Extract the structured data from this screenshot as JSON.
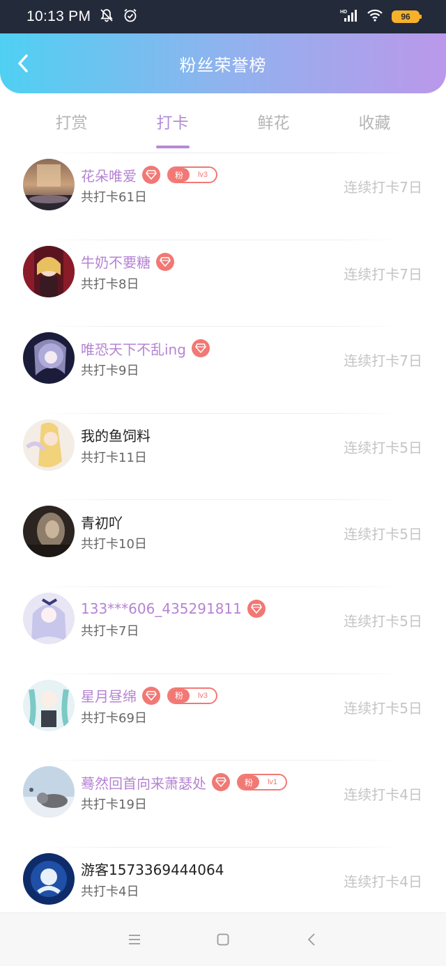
{
  "status_bar": {
    "time": "10:13 PM",
    "battery": "96"
  },
  "header": {
    "title": "粉丝荣誉榜"
  },
  "tabs": [
    {
      "label": "打赏",
      "active": false
    },
    {
      "label": "打卡",
      "active": true
    },
    {
      "label": "鲜花",
      "active": false
    },
    {
      "label": "收藏",
      "active": false
    }
  ],
  "rows": [
    {
      "name": "花朵唯爱",
      "vip": true,
      "fan_badge": "粉",
      "level": "lv3",
      "total": "共打卡61日",
      "streak": "连续打卡7日"
    },
    {
      "name": "牛奶不要糖",
      "vip": true,
      "total": "共打卡8日",
      "streak": "连续打卡7日"
    },
    {
      "name": "唯恐天下不乱ing",
      "vip": true,
      "total": "共打卡9日",
      "streak": "连续打卡7日"
    },
    {
      "name": "我的鱼饲料",
      "vip": false,
      "total": "共打卡11日",
      "streak": "连续打卡5日"
    },
    {
      "name": "青初吖",
      "vip": false,
      "total": "共打卡10日",
      "streak": "连续打卡5日"
    },
    {
      "name": "133***606_435291811",
      "vip": true,
      "total": "共打卡7日",
      "streak": "连续打卡5日"
    },
    {
      "name": "星月昼绵",
      "vip": true,
      "fan_badge": "粉",
      "level": "lv3",
      "total": "共打卡69日",
      "streak": "连续打卡5日"
    },
    {
      "name": "蓦然回首向来萧瑟处",
      "vip": true,
      "fan_badge": "粉",
      "level": "lv1",
      "total": "共打卡19日",
      "streak": "连续打卡4日"
    },
    {
      "name": "游客1573369444064",
      "vip": false,
      "total": "共打卡4日",
      "streak": "连续打卡4日"
    }
  ],
  "colors": {
    "accent": "#b48bd8",
    "vip_name": "#b583d3",
    "badge": "#f17874",
    "header_gradient": [
      "#4fd0f2",
      "#bb98ea"
    ]
  },
  "icons": {
    "status": [
      "mute-bell-icon",
      "alarm-icon",
      "signal-icon",
      "wifi-icon",
      "battery-icon"
    ],
    "header": "back-chevron-icon",
    "nav": [
      "menu-icon",
      "home-square-icon",
      "back-triangle-icon"
    ]
  }
}
